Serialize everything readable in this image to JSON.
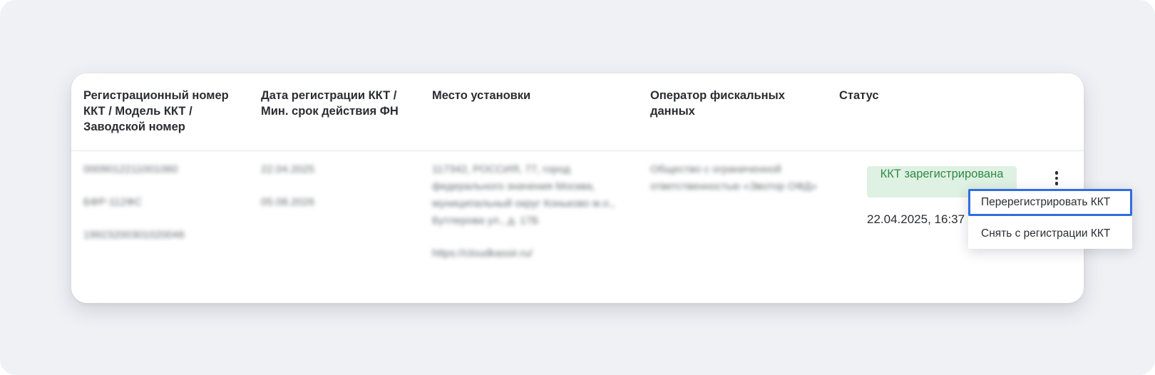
{
  "table": {
    "headers": [
      "Регистрационный номер ККТ / Модель ККТ / Заводской номер",
      "Дата регистрации ККТ / Мин. срок действия ФН",
      "Место установки",
      "Оператор фискальных данных",
      "Статус"
    ],
    "row": {
      "reg_number": "0009012211001060",
      "model": "БФР-112ФС",
      "serial": "19923200301020046",
      "reg_date": "22.04.2025",
      "fn_date": "05.08.2026",
      "address": "117342, РОССИЯ, 77, город федерального значения Москва, муниципальный округ Коньково м.о., Бутлерова ул., д. 17Б",
      "address_url": "https://cloudkassir.ru/",
      "operator": "Общество с ограниченной ответственностью «Эвотор ОФД»",
      "status_label": "ККТ зарегистрирована",
      "status_date": "22.04.2025, 16:37"
    },
    "blur": true
  },
  "context_menu": {
    "items": [
      "Перерегистрировать ККТ",
      "Снять с регистрации ККТ"
    ],
    "highlighted_index": 0
  },
  "colors": {
    "background": "#f0f1f5",
    "status_bg": "#dff1e2",
    "status_text": "#2f8a47",
    "highlight_border": "#2f6de1"
  },
  "icons": {
    "row_actions": "more-vertical-icon"
  }
}
